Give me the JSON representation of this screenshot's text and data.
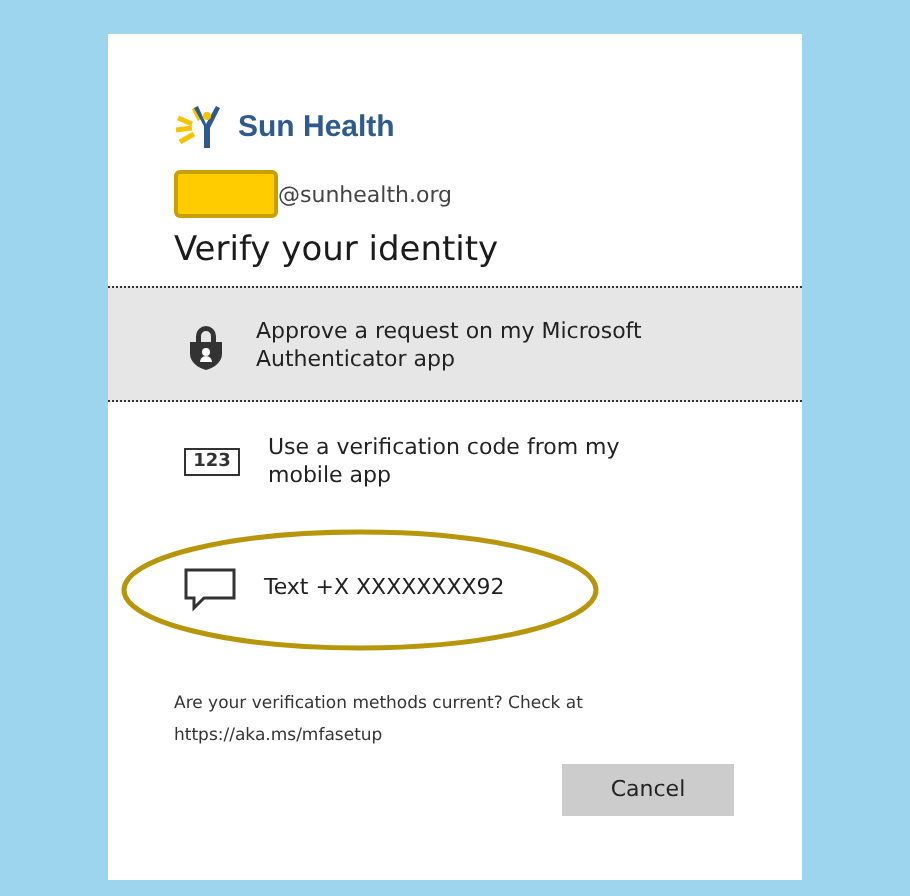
{
  "logo": {
    "name": "Sun Health"
  },
  "account": {
    "domain": "@sunhealth.org",
    "redacted": true
  },
  "title": "Verify your identity",
  "options": [
    {
      "kind": "authenticator",
      "label": "Approve a request on my Microsoft Authenticator app",
      "selected": true,
      "circled": false
    },
    {
      "kind": "code",
      "label": "Use a verification code from my mobile app",
      "icon_text": "123",
      "selected": false,
      "circled": false
    },
    {
      "kind": "text",
      "label": "Text +X XXXXXXXX92",
      "selected": false,
      "circled": true
    }
  ],
  "note": "Are your verification methods current? Check at https://aka.ms/mfasetup",
  "buttons": [
    {
      "label": "Cancel"
    }
  ]
}
